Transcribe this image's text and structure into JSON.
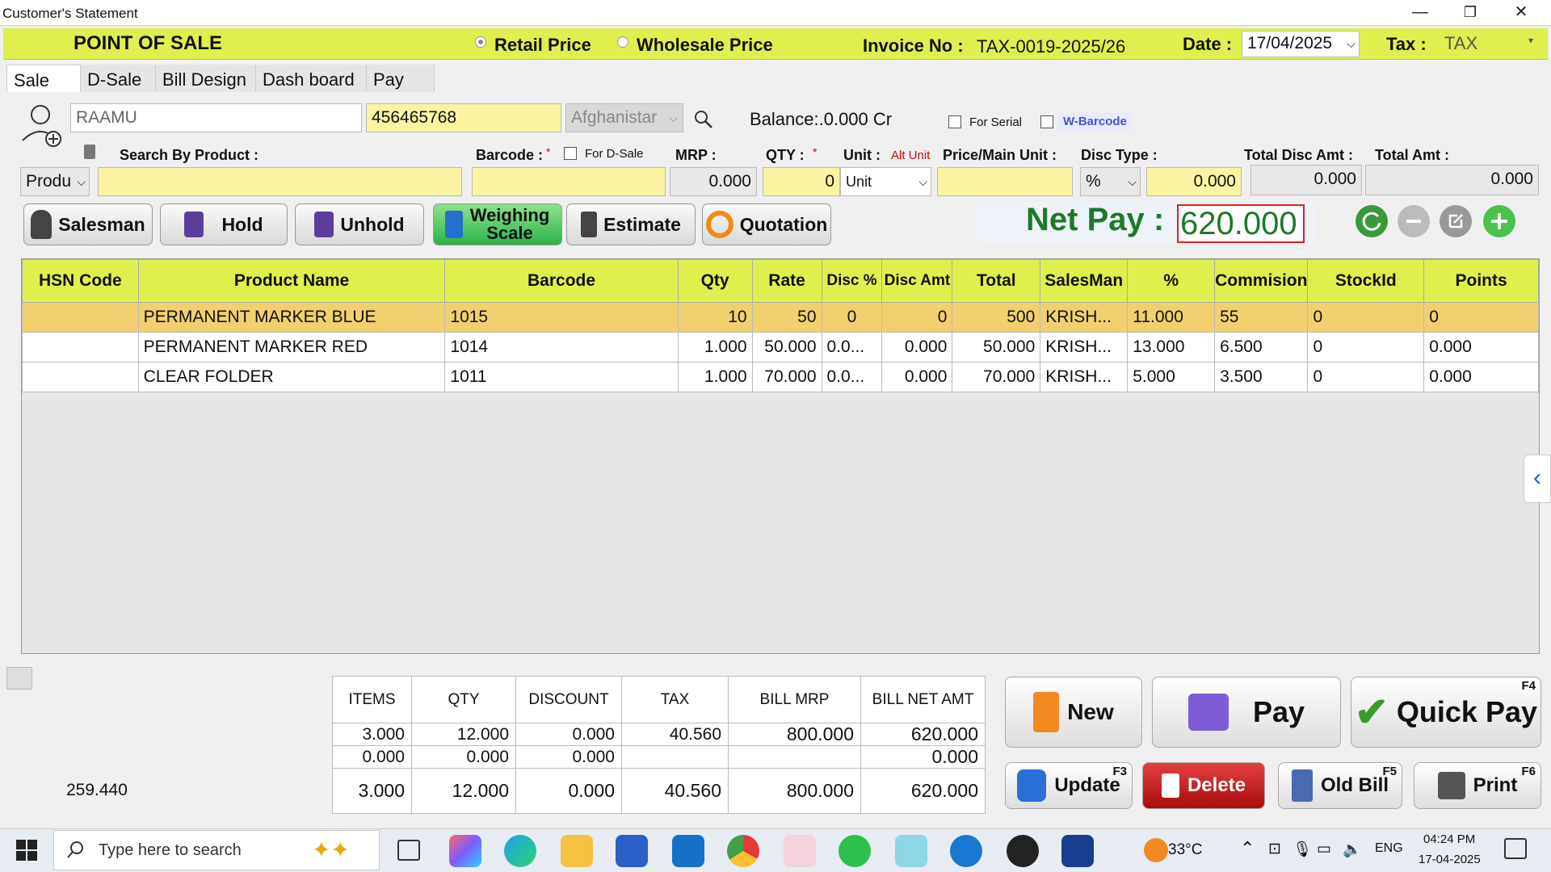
{
  "window": {
    "title": "Customer's Statement",
    "minimize": "—",
    "restore": "❐",
    "close": "✕"
  },
  "header": {
    "title": "POINT OF SALE",
    "retail": "Retail Price",
    "wholesale": "Wholesale Price",
    "invoice_label": "Invoice No :",
    "invoice_no": "TAX-0019-2025/26",
    "date_label": "Date :",
    "date": "17/04/2025",
    "tax_label": "Tax :",
    "tax": "TAX"
  },
  "tabs": [
    "Sale",
    "D-Sale",
    "Bill Design",
    "Dash board",
    "Pay"
  ],
  "customer": {
    "name": "RAAMU",
    "phone": "456465768",
    "country": "Afghanistar",
    "balance": "Balance:.0.000 Cr",
    "for_serial": "For Serial",
    "w_barcode": "W-Barcode"
  },
  "entry": {
    "search_label": "Search By Product :",
    "barcode_label": "Barcode :",
    "for_dsale": "For D-Sale",
    "mrp_label": "MRP :",
    "qty_label": "QTY :",
    "unit_label": "Unit :",
    "alt_unit": "Alt Unit",
    "price_label": "Price/Main Unit :",
    "disc_type_label": "Disc Type :",
    "total_disc_label": "Total Disc Amt :",
    "total_amt_label": "Total Amt :",
    "product_select": "Produ",
    "mrp": "0.000",
    "qty": "0",
    "unit": "Unit",
    "disc_type": "%",
    "disc": "0.000",
    "total_disc": "0.000",
    "total_amt": "0.000"
  },
  "buttons": {
    "salesman": "Salesman",
    "hold": "Hold",
    "unhold": "Unhold",
    "weighing": "Weighing Scale",
    "estimate": "Estimate",
    "quotation": "Quotation"
  },
  "netpay": {
    "label": "Net Pay :",
    "value": "620.000"
  },
  "grid": {
    "headers": [
      "HSN Code",
      "Product Name",
      "Barcode",
      "Qty",
      "Rate",
      "Disc %",
      "Disc Amt",
      "Total",
      "SalesMan",
      "%",
      "Commision",
      "StockId",
      "Points"
    ],
    "rows": [
      [
        "",
        "PERMANENT MARKER BLUE",
        "1015",
        "10",
        "50",
        "0",
        "0",
        "500",
        "KRISH...",
        "11.000",
        "55",
        "0",
        "0"
      ],
      [
        "",
        "PERMANENT MARKER RED",
        "1014",
        "1.000",
        "50.000",
        "0.0...",
        "0.000",
        "50.000",
        "KRISH...",
        "13.000",
        "6.500",
        "0",
        "0.000"
      ],
      [
        "",
        "CLEAR FOLDER",
        "1011",
        "1.000",
        "70.000",
        "0.0...",
        "0.000",
        "70.000",
        "KRISH...",
        "5.000",
        "3.500",
        "0",
        "0.000"
      ]
    ]
  },
  "footer": {
    "left_value": "259.440",
    "headers": [
      "ITEMS",
      "QTY",
      "DISCOUNT",
      "TAX",
      "BILL MRP",
      "BILL NET AMT"
    ],
    "row1": [
      "3.000",
      "12.000",
      "0.000",
      "40.560",
      "800.000",
      "620.000"
    ],
    "row2": [
      "0.000",
      "0.000",
      "0.000",
      "",
      "",
      "0.000"
    ],
    "row3": [
      "3.000",
      "12.000",
      "0.000",
      "40.560",
      "800.000",
      "620.000"
    ]
  },
  "actions": {
    "new": "New",
    "pay": "Pay",
    "quick_pay": "Quick Pay",
    "quick_key": "F4",
    "update": "Update",
    "update_key": "F3",
    "delete": "Delete",
    "old_bill": "Old Bill",
    "old_key": "F5",
    "print": "Print",
    "print_key": "F6"
  },
  "taskbar": {
    "search": "Type here to search",
    "weather": "33°C",
    "lang": "ENG",
    "time": "04:24 PM",
    "date": "17-04-2025"
  }
}
